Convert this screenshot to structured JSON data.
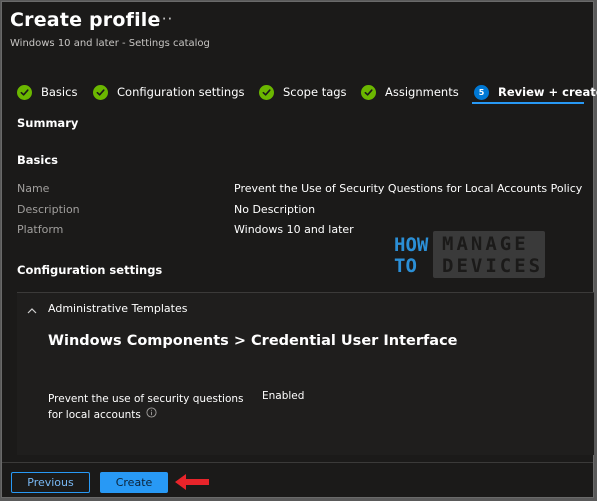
{
  "header": {
    "title": "Create profile",
    "more_label": "···",
    "subtitle": "Windows 10 and later - Settings catalog"
  },
  "tabs": [
    {
      "label": "Basics",
      "state": "complete"
    },
    {
      "label": "Configuration settings",
      "state": "complete"
    },
    {
      "label": "Scope tags",
      "state": "complete"
    },
    {
      "label": "Assignments",
      "state": "complete"
    },
    {
      "label": "Review + create",
      "state": "active",
      "step": "5"
    }
  ],
  "summary": {
    "heading": "Summary",
    "basics_heading": "Basics",
    "fields": [
      {
        "label": "Name",
        "value": "Prevent the Use of Security Questions for Local Accounts Policy"
      },
      {
        "label": "Description",
        "value": "No Description"
      },
      {
        "label": "Platform",
        "value": "Windows 10 and later"
      }
    ],
    "config_heading": "Configuration settings"
  },
  "config": {
    "section_label": "Administrative Templates",
    "category": "Windows Components > Credential User Interface",
    "setting_name": "Prevent the use of security questions for local accounts",
    "setting_value": "Enabled"
  },
  "watermark": {
    "line1_left": "HOW",
    "line2_left": "TO",
    "line1_right": "MANAGE",
    "line2_right": "DEVICES"
  },
  "footer": {
    "previous_label": "Previous",
    "create_label": "Create"
  },
  "colors": {
    "accent": "#2899f5",
    "success": "#6bb700",
    "annotation_arrow": "#e8242a"
  }
}
